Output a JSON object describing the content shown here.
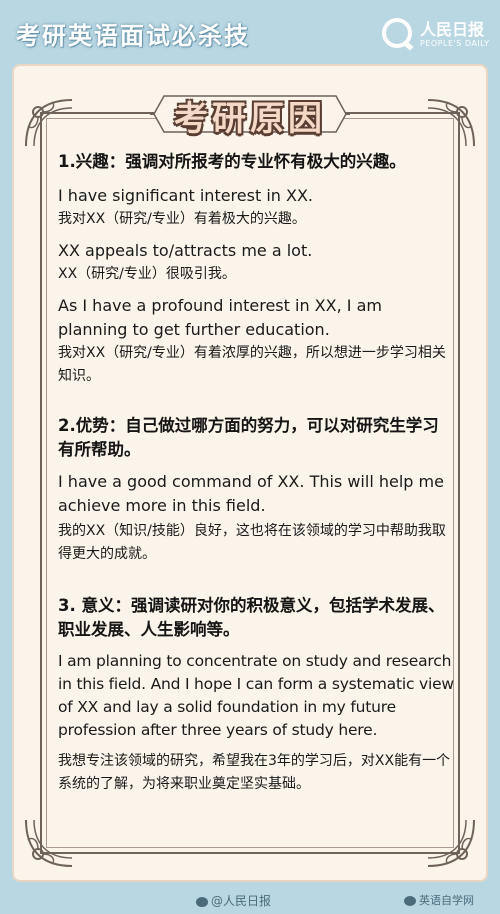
{
  "header": {
    "title": "考研英语面试必杀技",
    "logo_cn": "人民日报",
    "logo_en": "PEOPLE'S DAILY"
  },
  "banner": {
    "title": "考研原因"
  },
  "sections": [
    {
      "heading": "1.兴趣：强调对所报考的专业怀有极大的兴趣。",
      "items": [
        {
          "type": "en",
          "text": "I have significant interest in XX."
        },
        {
          "type": "cn",
          "text": "我对XX（研究/专业）有着极大的兴趣。"
        },
        {
          "type": "en",
          "text": "XX appeals to/attracts me a lot."
        },
        {
          "type": "cn",
          "text": "XX（研究/专业）很吸引我。"
        },
        {
          "type": "en",
          "text": "As I have a profound interest in XX, I am planning to get further education."
        },
        {
          "type": "cn",
          "text": "我对XX（研究/专业）有着浓厚的兴趣，所以想进一步学习相关知识。"
        }
      ]
    },
    {
      "heading": "2.优势：自己做过哪方面的努力，可以对研究生学习有所帮助。",
      "items": [
        {
          "type": "en",
          "text": "I have a good command of XX. This will help me achieve more in this field."
        },
        {
          "type": "cn",
          "text": "我的XX（知识/技能）良好，这也将在该领域的学习中帮助我取得更大的成就。"
        }
      ]
    },
    {
      "heading": "3. 意义：强调读研对你的积极意义，包括学术发展、职业发展、人生影响等。",
      "items": [
        {
          "type": "en",
          "text": "I am planning to concentrate on study and research in this field. And I hope I can form a systematic view of XX and lay a solid foundation in my future profession after three years of study here."
        },
        {
          "type": "cn",
          "text": "我想专注该领域的研究，希望我在3年的学习后，对XX能有一个系统的了解，为将来职业奠定坚实基础。"
        }
      ]
    }
  ],
  "footer": {
    "weibo": "@人民日报",
    "wechat": "英语自学网"
  }
}
